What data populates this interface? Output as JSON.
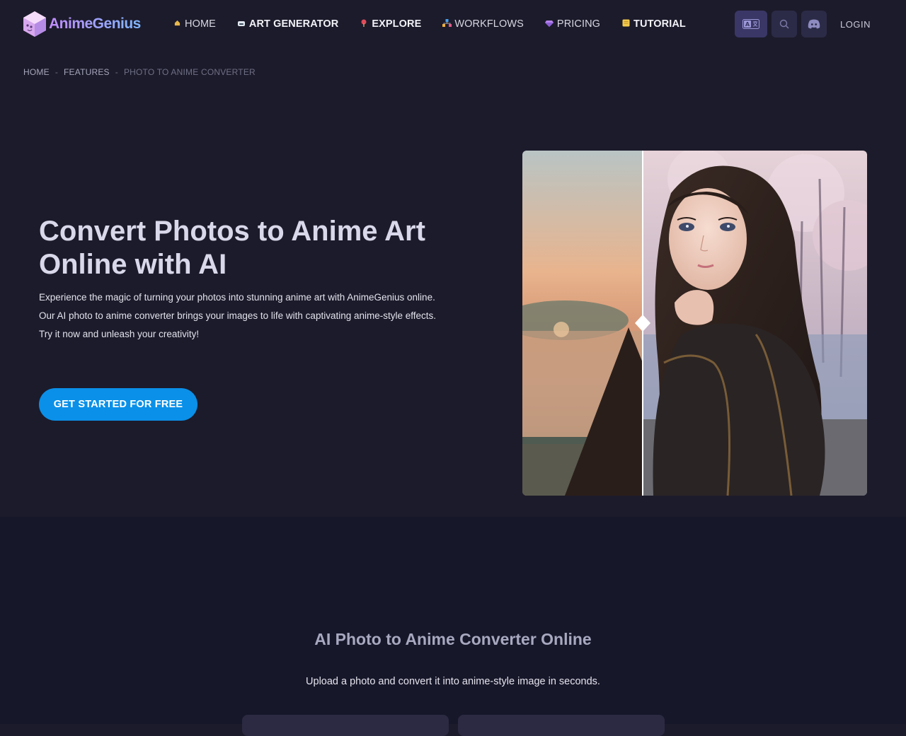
{
  "brand": {
    "name": "AnimeGenius"
  },
  "nav": [
    {
      "label": "HOME",
      "icon": "home-icon"
    },
    {
      "label": "ART GENERATOR",
      "icon": "robot-icon"
    },
    {
      "label": "EXPLORE",
      "icon": "explore-pin-icon"
    },
    {
      "label": "WORKFLOWS",
      "icon": "workflow-icon"
    },
    {
      "label": "PRICING",
      "icon": "diamond-icon"
    },
    {
      "label": "TUTORIAL",
      "icon": "tutorial-icon"
    }
  ],
  "header": {
    "login_label": "LOGIN"
  },
  "breadcrumb": {
    "items": [
      "HOME",
      "FEATURES",
      "PHOTO TO ANIME CONVERTER"
    ],
    "separator": "-"
  },
  "hero": {
    "title": "Convert Photos to Anime Art Online with AI",
    "desc": [
      "Experience the magic of turning your photos into stunning anime art with AnimeGenius online.",
      "Our AI photo to anime converter brings your images to life with captivating anime-style effects.",
      "Try it now and unleash your creativity!"
    ],
    "cta_label": "GET STARTED FOR FREE"
  },
  "section": {
    "title": "AI Photo to Anime Converter Online",
    "subtitle": "Upload a photo and convert it into anime-style image in seconds."
  },
  "colors": {
    "background": "#1c1b2b",
    "section_bg": "#17172a",
    "accent": "#0a90e8",
    "icon_button_bg": "#2c2b47"
  }
}
